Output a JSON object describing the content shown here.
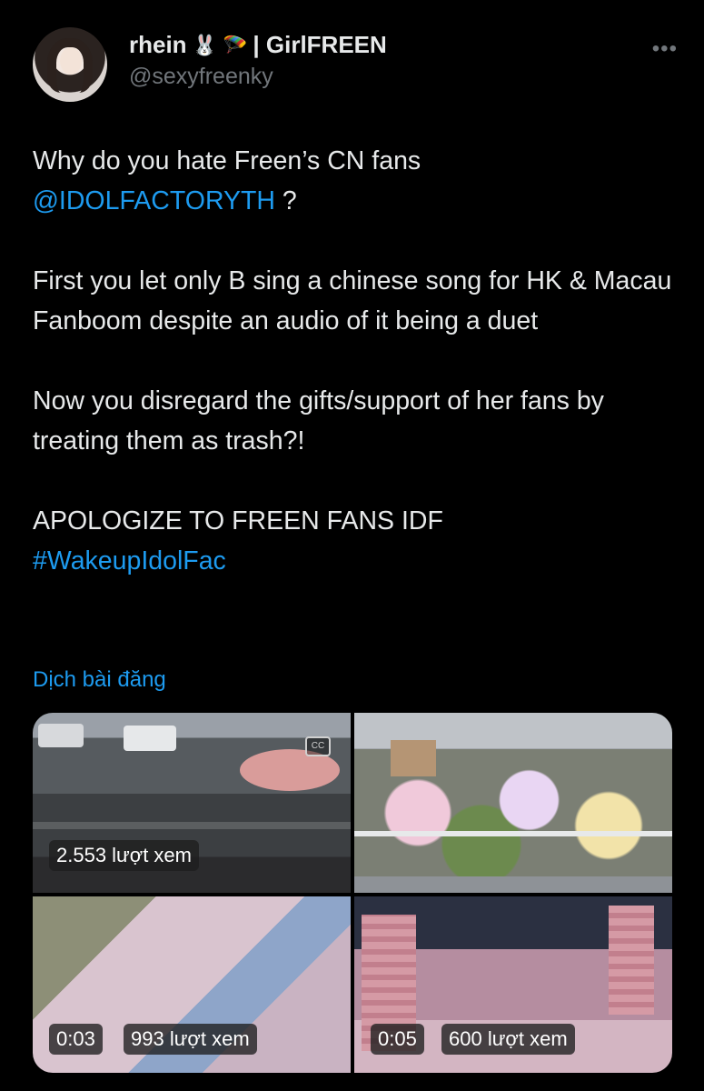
{
  "tweet": {
    "author": {
      "display_name": "rhein",
      "emoji_1": "🐰",
      "emoji_2": "🪂",
      "name_suffix": "| GirlFREEN",
      "handle": "@sexyfreenky"
    },
    "more_icon": "more-horizontal-icon",
    "text": {
      "line1": "Why do you hate Freen’s CN fans",
      "mention": "@IDOLFACTORYTH",
      "mention_suffix": " ?",
      "para2": "First you let only B sing a chinese song for HK & Macau Fanboom despite an audio of it being a duet",
      "para3": "Now you disregard the gifts/support of her fans by treating them as trash?!",
      "para4_line1": "APOLOGIZE TO FREEN FANS IDF",
      "hashtag": "#WakeupIdolFac"
    },
    "translate_label": "Dịch bài đăng",
    "media": [
      {
        "views": "2.553 lượt xem",
        "has_cc": true
      },
      {},
      {
        "duration": "0:03",
        "views": "993 lượt xem"
      },
      {
        "duration": "0:05",
        "views": "600 lượt xem"
      }
    ]
  },
  "colors": {
    "background": "#000000",
    "text": "#e7e9ea",
    "muted": "#71767b",
    "link": "#1d9bf0"
  }
}
